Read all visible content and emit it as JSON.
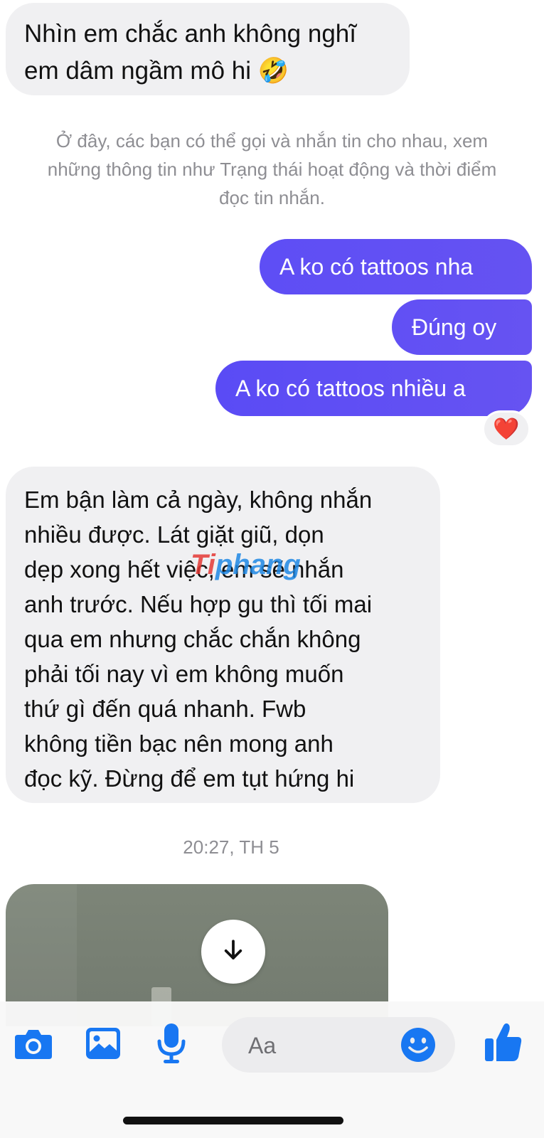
{
  "messages": {
    "m1": {
      "line1": "Nhìn em chắc anh không nghĩ",
      "line2": "em dâm ngầm mô hi",
      "emoji": "🤣"
    },
    "system_note": {
      "line1": "Ở đây, các bạn có thể gọi và nhắn tin cho nhau, xem",
      "line2": "những thông tin như Trạng thái hoạt động và thời điểm",
      "line3": "đọc tin nhắn."
    },
    "m2": {
      "text": "A ko có tattoos nha"
    },
    "m3": {
      "text": "Đúng oy"
    },
    "m4": {
      "text": "A ko có tattoos nhiều a",
      "reaction": "❤️"
    },
    "m5": {
      "lines": [
        "Em bận làm cả ngày, không nhắn",
        "nhiều được. Lát giặt giũ, dọn",
        "dẹp xong hết việc, em sẽ nhắn",
        "anh trước. Nếu hợp gu thì tối mai",
        "qua em nhưng chắc chắn không",
        "phải tối nay vì em không muốn",
        "thứ gì đến quá nhanh. Fwb",
        "không tiền bạc nên mong anh",
        "đọc kỹ. Đừng để em tụt hứng hi"
      ]
    },
    "timestamp": "20:27, TH 5"
  },
  "watermark": {
    "part1": "Ti",
    "part2": "phang",
    "color1": "#e53935",
    "color2": "#1e88e5"
  },
  "composer": {
    "placeholder": "Aa",
    "icons": [
      "camera-icon",
      "image-icon",
      "microphone-icon",
      "emoji-icon",
      "thumbs-up-icon"
    ]
  },
  "colors": {
    "outgoing_gradient_start": "#5b4cf5",
    "outgoing_gradient_end": "#6b55f2",
    "incoming_bubble": "#f0f0f2",
    "messenger_blue": "#1877f2",
    "meta_text": "#8e8e93"
  }
}
